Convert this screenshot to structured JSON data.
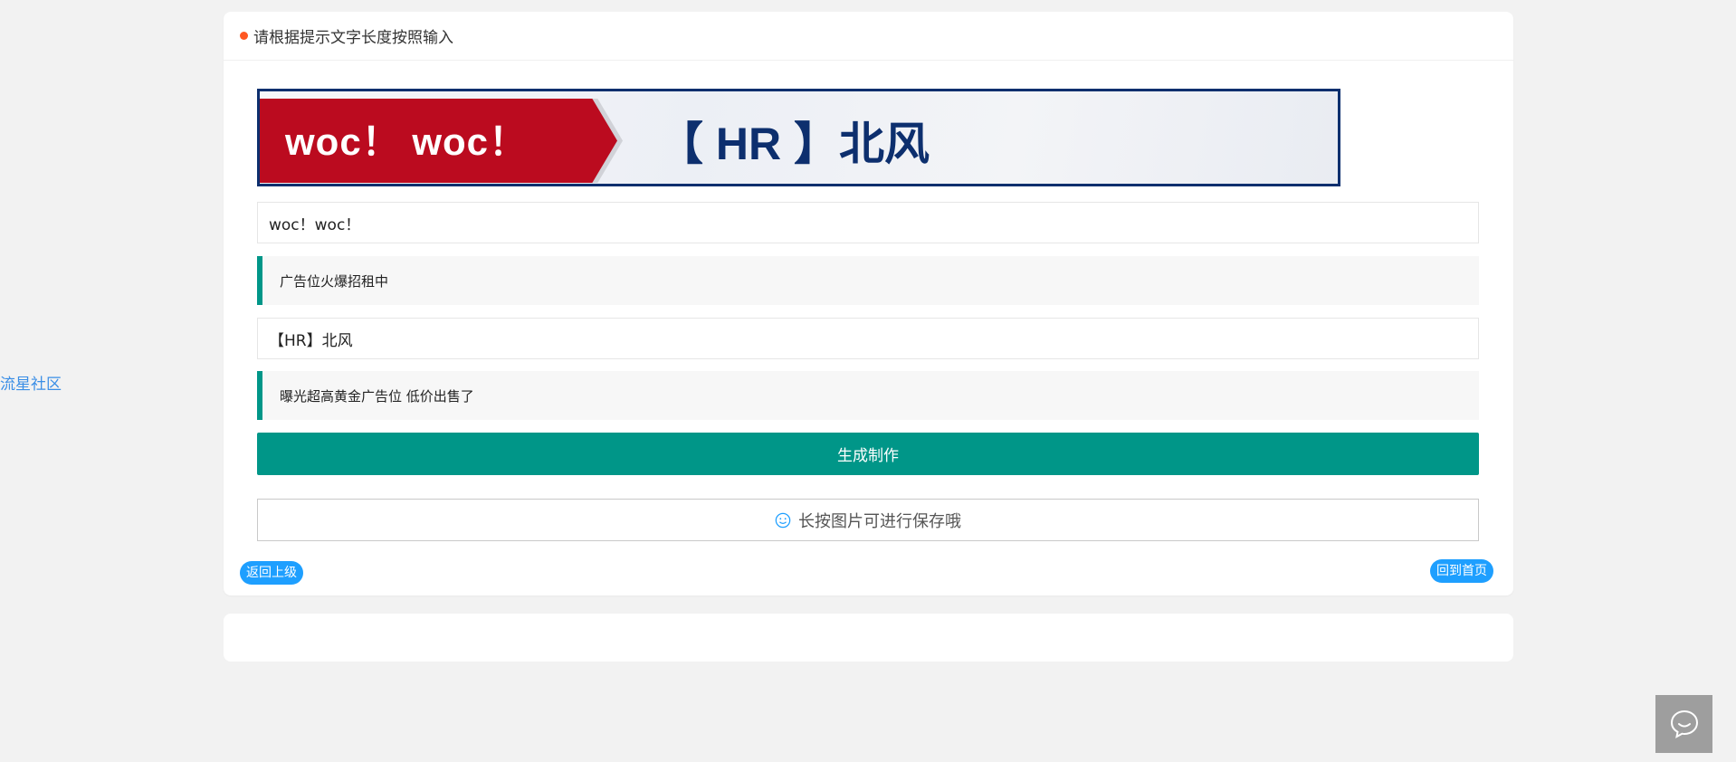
{
  "sidebar": {
    "community_link": "流星社区"
  },
  "form": {
    "header": "请根据提示文字长度按照输入",
    "banner": {
      "left_text": "woc！ woc！",
      "right_text": "【 HR 】北风"
    },
    "field1": {
      "value": "woc！woc！"
    },
    "tip1": "广告位火爆招租中",
    "field2": {
      "value": "【HR】北风"
    },
    "tip2": "曝光超高黄金广告位  低价出售了",
    "generate_label": "生成制作",
    "save_tip": "长按图片可进行保存哦",
    "back_label": "返回上级",
    "home_label": "回到首页"
  },
  "colors": {
    "accent": "#009688",
    "header_dot": "#ff5722",
    "banner_red": "#bb0b1f",
    "banner_blue": "#0d2f6e",
    "pill_blue": "#1e9fff",
    "link_blue": "#3a8ee6"
  },
  "icons": {
    "save_tip": "smile-icon",
    "chat": "chat-bubble-icon"
  }
}
